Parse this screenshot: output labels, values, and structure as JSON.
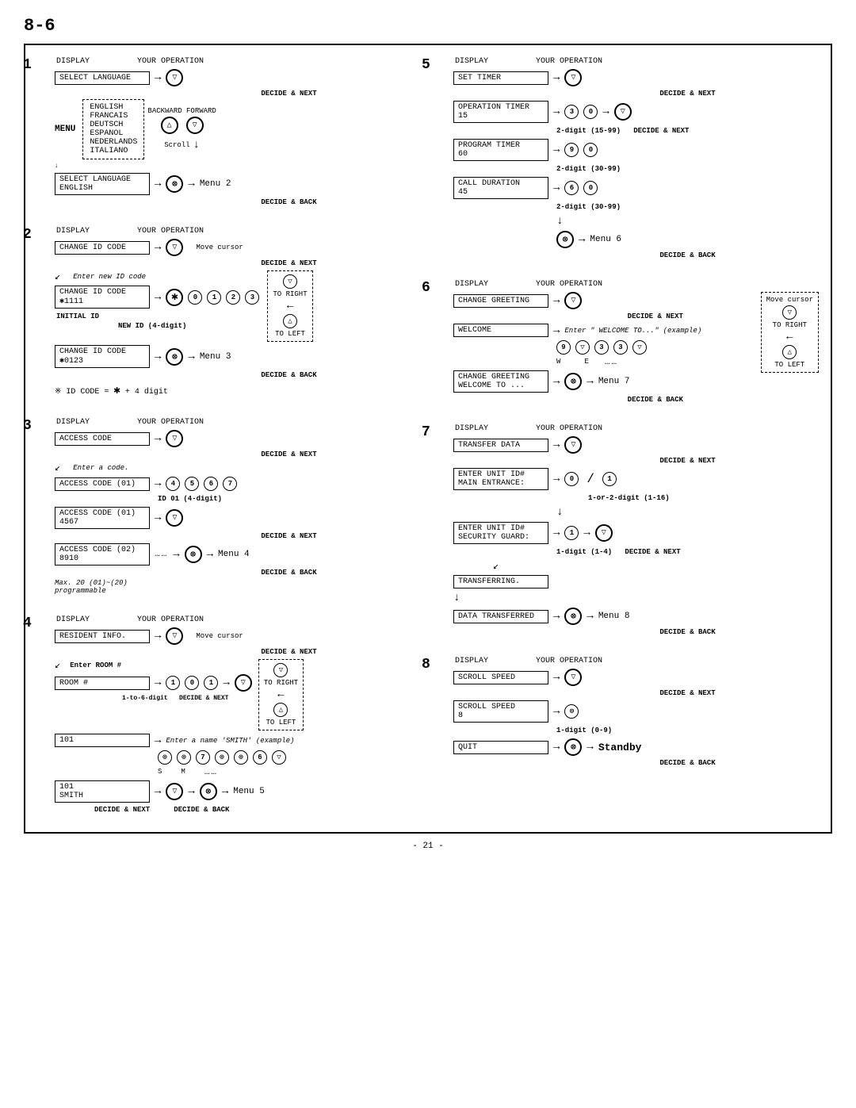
{
  "page": {
    "title": "8-6",
    "page_number": "- 21 -",
    "sections": {
      "left": [
        {
          "num": "1",
          "col1": "DISPLAY",
          "col2": "YOUR OPERATION",
          "rows": []
        }
      ]
    }
  }
}
